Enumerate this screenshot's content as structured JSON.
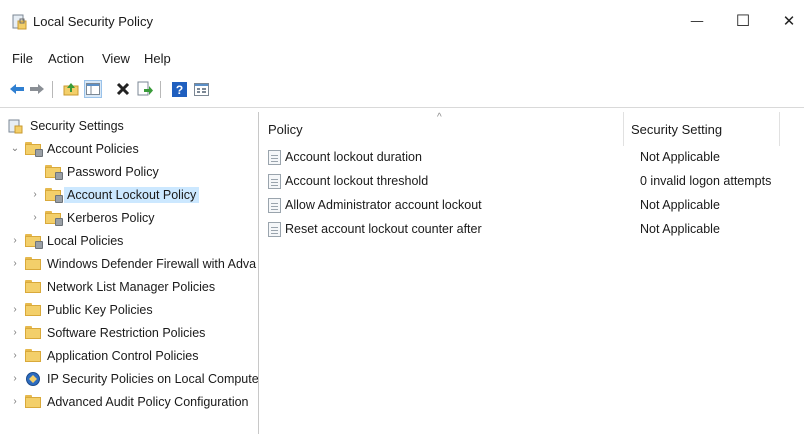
{
  "window": {
    "title": "Local Security Policy",
    "minimize_glyph": "—",
    "maximize_glyph": "☐",
    "close_glyph": "✕"
  },
  "menu": [
    "File",
    "Action",
    "View",
    "Help"
  ],
  "toolbar": {
    "icons": [
      "back-arrow-icon",
      "forward-arrow-icon",
      "up-folder-icon",
      "show-hide-tree-icon",
      "delete-icon",
      "export-list-icon",
      "help-icon",
      "properties-icon"
    ]
  },
  "tree": {
    "root": "Security Settings",
    "account_policies": "Account Policies",
    "password_policy": "Password Policy",
    "account_lockout_policy": "Account Lockout Policy",
    "kerberos_policy": "Kerberos Policy",
    "local_policies": "Local Policies",
    "firewall": "Windows Defender Firewall with Adva",
    "network_list": "Network List Manager Policies",
    "public_key": "Public Key Policies",
    "software_restriction": "Software Restriction Policies",
    "app_control": "Application Control Policies",
    "ip_security": "IP Security Policies on Local Compute",
    "audit": "Advanced Audit Policy Configuration"
  },
  "list": {
    "columns": [
      "Policy",
      "Security Setting"
    ],
    "rows": [
      {
        "policy": "Account lockout duration",
        "setting": "Not Applicable"
      },
      {
        "policy": "Account lockout threshold",
        "setting": "0 invalid logon attempts"
      },
      {
        "policy": "Allow Administrator account lockout",
        "setting": "Not Applicable"
      },
      {
        "policy": "Reset account lockout counter after",
        "setting": "Not Applicable"
      }
    ]
  },
  "colors": {
    "selection": "#cce8ff",
    "folder": "#f3cf6a",
    "help_blue": "#1f5fbf"
  }
}
